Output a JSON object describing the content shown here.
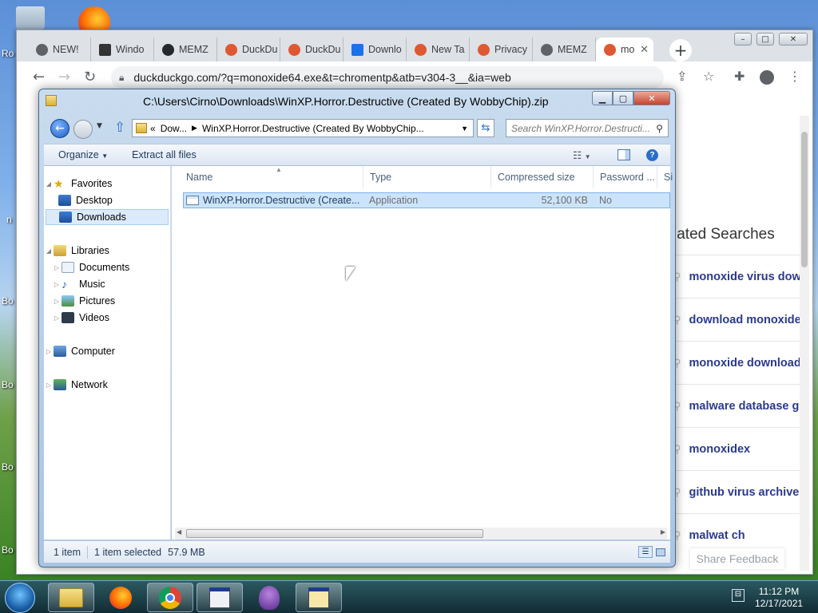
{
  "desktop": {
    "side_labels": [
      "Ro",
      "n",
      "Bo",
      "Bo",
      "Bo",
      "Bo",
      "Bo"
    ]
  },
  "browser": {
    "tabs": [
      {
        "label": "NEW!",
        "icon": "globe-icon",
        "color": "#5f6368"
      },
      {
        "label": "Windo",
        "icon": "archive-icon",
        "color": "#333333"
      },
      {
        "label": "MEMZ",
        "icon": "github-icon",
        "color": "#24292e"
      },
      {
        "label": "DuckDu",
        "icon": "duckduckgo-icon",
        "color": "#de5833"
      },
      {
        "label": "DuckDu",
        "icon": "duckduckgo-icon",
        "color": "#de5833"
      },
      {
        "label": "Downlo",
        "icon": "download-icon",
        "color": "#1a73e8"
      },
      {
        "label": "New Ta",
        "icon": "duckduckgo-icon",
        "color": "#de5833"
      },
      {
        "label": "Privacy",
        "icon": "duckduckgo-icon",
        "color": "#de5833"
      },
      {
        "label": "MEMZ",
        "icon": "globe-icon",
        "color": "#5f6368"
      },
      {
        "label": "mo",
        "icon": "duckduckgo-icon",
        "color": "#de5833",
        "active": true
      }
    ],
    "url": "duckduckgo.com/?q=monoxide64.exe&t=chromentp&atb=v304-3__&ia=web",
    "page": {
      "related_heading": "lated Searches",
      "related": [
        "monoxide virus dow",
        "download monoxide",
        "monoxide download",
        "malware database g",
        "monoxidex",
        "github virus archive",
        "malwat ch"
      ],
      "feedback": "Share Feedback"
    }
  },
  "explorer": {
    "title": "C:\\Users\\Cirno\\Downloads\\WinXP.Horror.Destructive  (Created By WobbyChip).zip",
    "breadcrumb": [
      "Dow...",
      "WinXP.Horror.Destructive  (Created By WobbyChip..."
    ],
    "search_placeholder": "Search WinXP.Horror.Destructi...",
    "commands": {
      "organize": "Organize",
      "extract": "Extract all files"
    },
    "nav": {
      "favorites": "Favorites",
      "desktop": "Desktop",
      "downloads": "Downloads",
      "libraries": "Libraries",
      "documents": "Documents",
      "music": "Music",
      "pictures": "Pictures",
      "videos": "Videos",
      "computer": "Computer",
      "network": "Network"
    },
    "columns": {
      "name": "Name",
      "type": "Type",
      "compressed": "Compressed size",
      "password": "Password ...",
      "size": "Si"
    },
    "rows": [
      {
        "name": "WinXP.Horror.Destructive  (Create...",
        "type": "Application",
        "compressed": "52,100 KB",
        "password": "No"
      }
    ],
    "status": {
      "count": "1 item",
      "selected": "1 item selected",
      "size": "57.9 MB"
    }
  },
  "taskbar": {
    "time": "11:12 PM",
    "date": "12/17/2021"
  }
}
